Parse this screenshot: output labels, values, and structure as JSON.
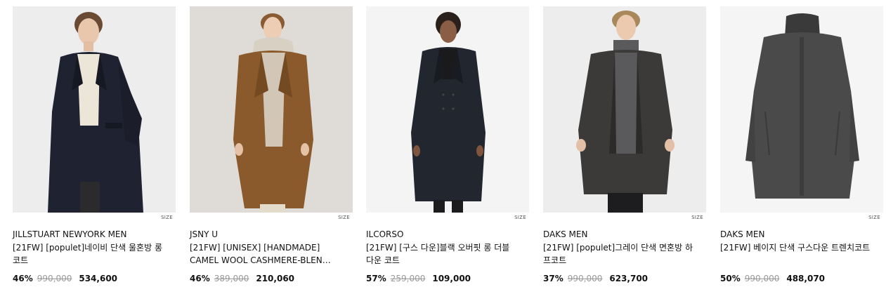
{
  "products": [
    {
      "brand": "JILLSTUART NEWYORK MEN",
      "name": "[21FW] [populet]네이비 단색 울혼방 롱코트",
      "discount": "46%",
      "original_price": "990,000",
      "sale_price": "534,600",
      "size_label": "SIZE",
      "image": "model-navy-long-coat",
      "colors": {
        "bg": "#ededed",
        "coat": "#1f2230",
        "inner": "#ece6d9",
        "pants": "#2b2b2e"
      }
    },
    {
      "brand": "JSNY U",
      "name": "[21FW] [UNISEX] [HANDMADE] CAMEL WOOL CASHMERE-BLEN…",
      "discount": "46%",
      "original_price": "389,000",
      "sale_price": "210,060",
      "size_label": "SIZE",
      "image": "model-camel-coat",
      "colors": {
        "bg": "#dfdbd6",
        "coat": "#8a5a2c",
        "inner": "#d9d0c4",
        "pants": "#e3dccb"
      }
    },
    {
      "brand": "ILCORSO",
      "name": "[21FW] [구스 다운]블랙 오버핏 롱 더블 다운 코트",
      "discount": "57%",
      "original_price": "259,000",
      "sale_price": "109,000",
      "size_label": "SIZE",
      "image": "model-black-down-coat",
      "colors": {
        "bg": "#f4f4f4",
        "coat": "#22262e",
        "inner": "#1a1a1d",
        "pants": "#1c1c1e"
      }
    },
    {
      "brand": "DAKS MEN",
      "name": "[21FW] [populet]그레이 단색 면혼방 하프코트",
      "discount": "37%",
      "original_price": "990,000",
      "sale_price": "623,700",
      "size_label": "SIZE",
      "image": "model-gray-half-coat",
      "colors": {
        "bg": "#ededed",
        "coat": "#3b3a38",
        "inner": "#5a5a5c",
        "pants": "#1d1d20"
      }
    },
    {
      "brand": "DAKS MEN",
      "name": "[21FW] 베이지 단색 구스다운 트렌치코트",
      "discount": "50%",
      "original_price": "990,000",
      "sale_price": "488,070",
      "size_label": "SIZE",
      "image": "gray-down-trench-coat",
      "colors": {
        "bg": "#f5f5f5",
        "coat": "#4a4a4a",
        "inner": "#3a3a3a",
        "pants": "#4a4a4a"
      }
    }
  ]
}
